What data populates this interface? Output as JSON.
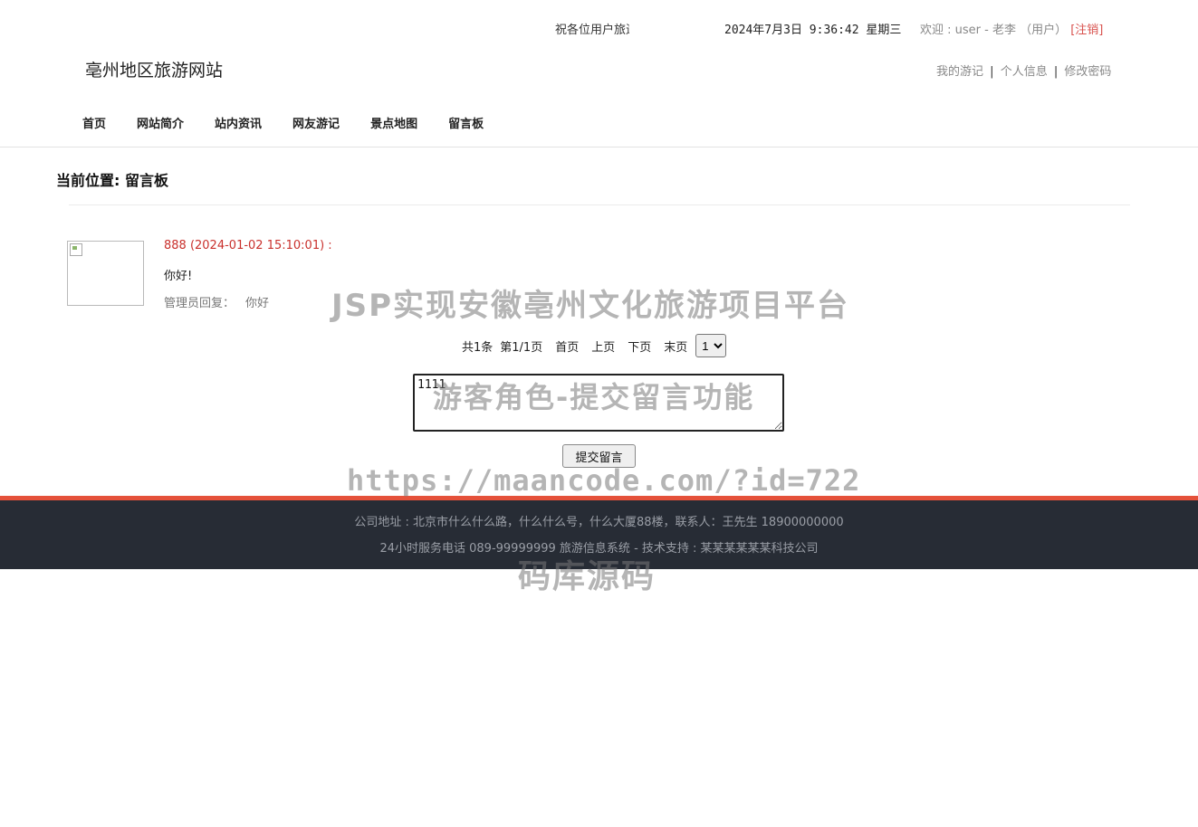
{
  "header": {
    "marquee": "祝各位用户旅途愉快",
    "clock": "2024年7月3日 9:36:42 星期三",
    "welcome": "欢迎 : user - 老李 （用户）",
    "logout_label": "[注销]",
    "site_title": "亳州地区旅游网站",
    "user_links": [
      "我的游记",
      "个人信息",
      "修改密码"
    ]
  },
  "nav": {
    "items": [
      "首页",
      "网站简介",
      "站内资讯",
      "网友游记",
      "景点地图",
      "留言板"
    ]
  },
  "breadcrumb": "当前位置: 留言板",
  "messages": [
    {
      "header": "888 (2024-01-02 15:10:01) :",
      "content": "你好!",
      "reply_label": "管理员回复：",
      "reply": "你好"
    }
  ],
  "pager": {
    "total": "共1条",
    "page": "第1/1页",
    "first": "首页",
    "prev": "上页",
    "next": "下页",
    "last": "末页",
    "selected": "1"
  },
  "form": {
    "message_value": "1111",
    "submit_label": "提交留言"
  },
  "footer": {
    "line1": "公司地址 : 北京市什么什么路，什么什么号，什么大厦88楼，联系人：王先生 18900000000",
    "line2": "24小时服务电话   089-99999999   旅游信息系统 - 技术支持 : 某某某某某某科技公司"
  },
  "watermark": {
    "title": "JSP实现安徽亳州文化旅游项目平台",
    "subtitle": "游客角色-提交留言功能",
    "url": "https://maancode.com/?id=722",
    "brand": "码库源码"
  },
  "colors": {
    "accent": "#e5513a",
    "footer_bg": "#272c35",
    "message_header": "#c9302c"
  }
}
